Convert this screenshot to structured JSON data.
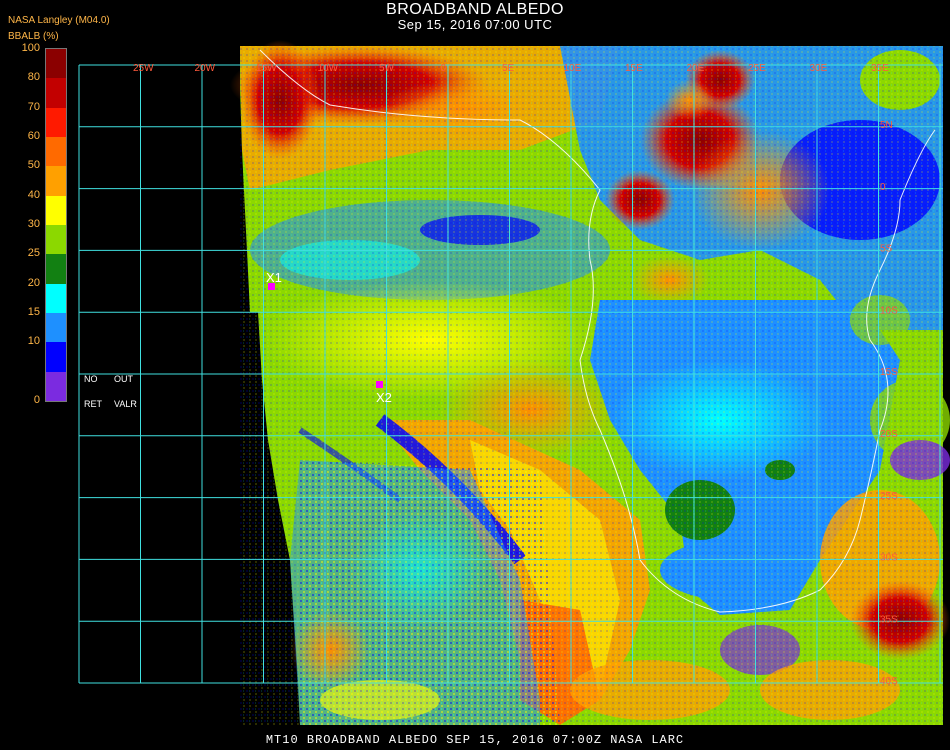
{
  "header": {
    "title": "BROADBAND ALBEDO",
    "datetime": "Sep 15, 2016 07:00 UTC",
    "agency": "NASA Langley (M04.0)",
    "units": "BBALB (%)"
  },
  "colorbar": {
    "ticks": [
      "100",
      "80",
      "70",
      "60",
      "50",
      "40",
      "30",
      "25",
      "20",
      "15",
      "10",
      "0"
    ],
    "colors": [
      "#8b0000",
      "#c20000",
      "#ff1a00",
      "#ff6a00",
      "#ffa000",
      "#ffff00",
      "#8cd800",
      "#128012",
      "#00ffff",
      "#1e90ff",
      "#0000ff",
      "#7b2be0"
    ],
    "no_retrieval": [
      "NO",
      "OUT",
      "RET",
      "VALR"
    ]
  },
  "grid": {
    "lon_labels": [
      "25W",
      "20W",
      "15W",
      "10W",
      "5W",
      "0",
      "5E",
      "10E",
      "15E",
      "20E",
      "25E",
      "30E",
      "35E"
    ],
    "lat_labels": [
      "5N",
      "0",
      "5S",
      "10S",
      "15S",
      "20S",
      "25S",
      "30S",
      "35S",
      "40S"
    ]
  },
  "markers": [
    {
      "label": "X1"
    },
    {
      "label": "X2"
    }
  ],
  "footer": "MT10  BROADBAND ALBEDO  SEP 15, 2016 07:00Z  NASA LARC"
}
